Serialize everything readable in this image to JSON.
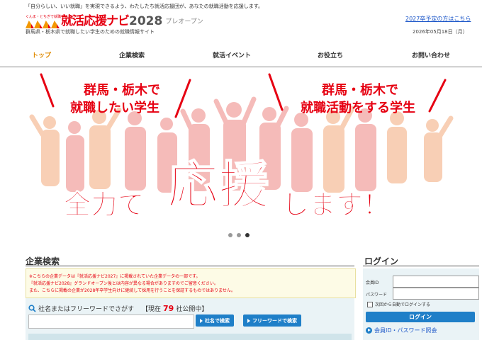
{
  "header": {
    "top_line": "「自分らしい、いい就職」を実現できるよう、わたしたち就活応援団が、あなたの就職活動を応援します。",
    "logo_small": "ぐんま・とちぎで就職するなら",
    "logo_title": "就活応援ナビ",
    "logo_year": "2028",
    "logo_sub": "プレオープン",
    "tagline": "群馬県・栃木県で就職したい学生のための就職情報サイト",
    "link_2027": "2027卒予定の方はこちら",
    "date": "2026年05月18日（月）"
  },
  "nav": {
    "items": [
      {
        "label": "トップ"
      },
      {
        "label": "企業検索"
      },
      {
        "label": "就活イベント"
      },
      {
        "label": "お役立ち"
      },
      {
        "label": "お問い合わせ"
      }
    ]
  },
  "hero": {
    "left_callout_1": "群馬・栃木で",
    "left_callout_2": "就職したい学生",
    "right_callout_1": "群馬・栃木で",
    "right_callout_2": "就職活動をする学生",
    "main_1": "全力で",
    "main_2": "応援",
    "main_3": "します！",
    "slide_count": 3,
    "active_slide": 3
  },
  "company_search": {
    "title": "企業検索",
    "notice_1": "※こちらの企業データは『就活応援ナビ2027』に掲載されていた企業データの一部です。",
    "notice_2": "『就活応援ナビ2028』グランドオープン後とは内容が異なる場合がありますのでご留意ください。",
    "notice_3": "また、こちらに掲載の企業が2028年卒学生向けに継続して採用を行うことを保証するものではありません。",
    "search_label": "社名またはフリーワードでさがす",
    "count_prefix": "【現在",
    "count_value": "79",
    "count_suffix": "社公開中】",
    "input_value": "",
    "btn_company": "社名で検索",
    "btn_freeword": "フリーワードで検索"
  },
  "login": {
    "title": "ログイン",
    "id_label": "会員ID",
    "pw_label": "パスワード",
    "auto_login": "次回から自動でログインする",
    "button": "ログイン",
    "link": "会員ID・パスワード照会"
  },
  "colors": {
    "accent_red": "#e60012",
    "accent_orange": "#f39800",
    "button_blue": "#1f7fc8",
    "link_blue": "#1a55c8"
  }
}
